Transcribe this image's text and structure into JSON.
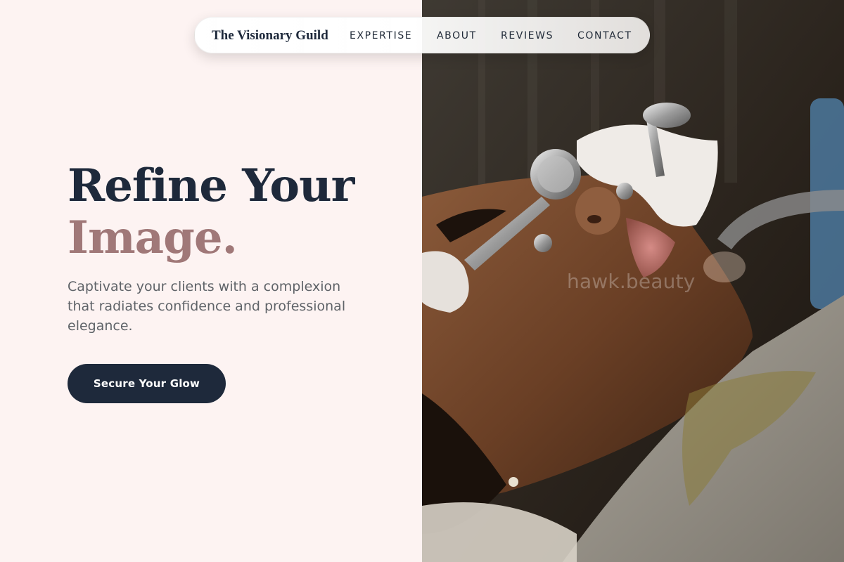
{
  "brand": {
    "name": "The Visionary Guild"
  },
  "nav": {
    "items": [
      {
        "label": "EXPERTISE"
      },
      {
        "label": "ABOUT"
      },
      {
        "label": "REVIEWS"
      },
      {
        "label": "CONTACT"
      }
    ]
  },
  "hero": {
    "headline_line1": "Refine Your",
    "headline_line2": "Image.",
    "subtitle": "Captivate your clients with a complexion that radiates confidence and professional elegance.",
    "cta_label": "Secure Your Glow",
    "photo_watermark": "hawk.beauty"
  },
  "colors": {
    "page_background": "#fdf3f2",
    "primary_navy": "#1e293b",
    "accent_mauve": "#a07878",
    "body_text_gray": "#5f6368"
  }
}
